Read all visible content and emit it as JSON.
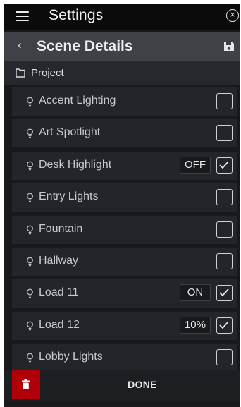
{
  "header": {
    "title": "Settings",
    "menu_icon": "hamburger-icon",
    "close_icon": "close-icon"
  },
  "subheader": {
    "title": "Scene Details",
    "back_icon": "chevron-left-icon",
    "save_icon": "save-icon"
  },
  "project": {
    "label": "Project",
    "icon": "folder-icon"
  },
  "loads": [
    {
      "label": "Accent Lighting",
      "state": "",
      "checked": false
    },
    {
      "label": "Art Spotlight",
      "state": "",
      "checked": false
    },
    {
      "label": "Desk Highlight",
      "state": "OFF",
      "checked": true
    },
    {
      "label": "Entry Lights",
      "state": "",
      "checked": false
    },
    {
      "label": "Fountain",
      "state": "",
      "checked": false
    },
    {
      "label": "Hallway",
      "state": "",
      "checked": false
    },
    {
      "label": "Load 11",
      "state": "ON",
      "checked": true
    },
    {
      "label": "Load 12",
      "state": "10%",
      "checked": true
    },
    {
      "label": "Lobby Lights",
      "state": "",
      "checked": false
    }
  ],
  "footer": {
    "done_label": "DONE",
    "delete_icon": "trash-icon"
  },
  "colors": {
    "delete": "#b0000a",
    "background": "#17191c",
    "row": "#22252a",
    "subheader": "#3e4246"
  }
}
